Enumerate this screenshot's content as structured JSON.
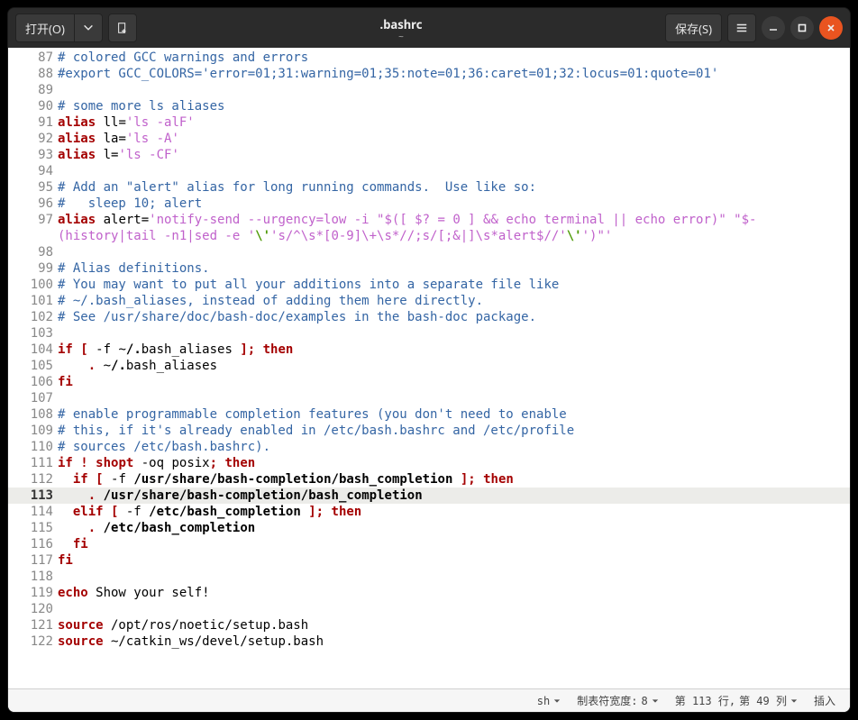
{
  "titlebar": {
    "open_label": "打开(O)",
    "save_label": "保存(S)",
    "title": ".bashrc",
    "subtitle": "~"
  },
  "editor": {
    "lines": [
      {
        "n": 87,
        "t": "cm",
        "txt": "# colored GCC warnings and errors"
      },
      {
        "n": 88,
        "t": "cm",
        "txt": "#export GCC_COLORS='error=01;31:warning=01;35:note=01;36:caret=01;32:locus=01:quote=01'"
      },
      {
        "n": 89,
        "t": "pn",
        "txt": ""
      },
      {
        "n": 90,
        "t": "cm",
        "txt": "# some more ls aliases"
      },
      {
        "n": 91,
        "t": "alias",
        "name": "alias",
        "rest": " ll=",
        "str": "'ls -alF'"
      },
      {
        "n": 92,
        "t": "alias",
        "name": "alias",
        "rest": " la=",
        "str": "'ls -A'"
      },
      {
        "n": 93,
        "t": "alias",
        "name": "alias",
        "rest": " l=",
        "str": "'ls -CF'"
      },
      {
        "n": 94,
        "t": "pn",
        "txt": ""
      },
      {
        "n": 95,
        "t": "cm",
        "txt": "# Add an \"alert\" alias for long running commands.  Use like so:"
      },
      {
        "n": 96,
        "t": "cm",
        "txt": "#   sleep 10; alert"
      },
      {
        "n": 97,
        "t": "alert1"
      },
      {
        "n": 0,
        "t": "alert2"
      },
      {
        "n": 98,
        "t": "pn",
        "txt": ""
      },
      {
        "n": 99,
        "t": "cm",
        "txt": "# Alias definitions."
      },
      {
        "n": 100,
        "t": "cm",
        "txt": "# You may want to put all your additions into a separate file like"
      },
      {
        "n": 101,
        "t": "cm",
        "txt": "# ~/.bash_aliases, instead of adding them here directly."
      },
      {
        "n": 102,
        "t": "cm",
        "txt": "# See /usr/share/doc/bash-doc/examples in the bash-doc package."
      },
      {
        "n": 103,
        "t": "pn",
        "txt": ""
      },
      {
        "n": 104,
        "t": "if1"
      },
      {
        "n": 105,
        "t": "dot1"
      },
      {
        "n": 106,
        "t": "kw",
        "txt": "fi"
      },
      {
        "n": 107,
        "t": "pn",
        "txt": ""
      },
      {
        "n": 108,
        "t": "cm",
        "txt": "# enable programmable completion features (you don't need to enable"
      },
      {
        "n": 109,
        "t": "cm",
        "txt": "# this, if it's already enabled in /etc/bash.bashrc and /etc/profile"
      },
      {
        "n": 110,
        "t": "cm",
        "txt": "# sources /etc/bash.bashrc)."
      },
      {
        "n": 111,
        "t": "shopt"
      },
      {
        "n": 112,
        "t": "if2"
      },
      {
        "n": 113,
        "t": "dot2",
        "current": true
      },
      {
        "n": 114,
        "t": "elif"
      },
      {
        "n": 115,
        "t": "dot3"
      },
      {
        "n": 116,
        "t": "fiin"
      },
      {
        "n": 117,
        "t": "kw",
        "txt": "fi"
      },
      {
        "n": 118,
        "t": "pn",
        "txt": ""
      },
      {
        "n": 119,
        "t": "echo"
      },
      {
        "n": 120,
        "t": "pn",
        "txt": ""
      },
      {
        "n": 121,
        "t": "src",
        "path": "/opt/ros/noetic/setup.bash"
      },
      {
        "n": 122,
        "t": "src",
        "path": "~/catkin_ws/devel/setup.bash"
      }
    ]
  },
  "status": {
    "lang": "sh",
    "tab_label": "制表符宽度:",
    "tab_width": "8",
    "pos_label_row": "第 113 行,",
    "pos_label_col": "第 49 列",
    "mode": "插入"
  }
}
